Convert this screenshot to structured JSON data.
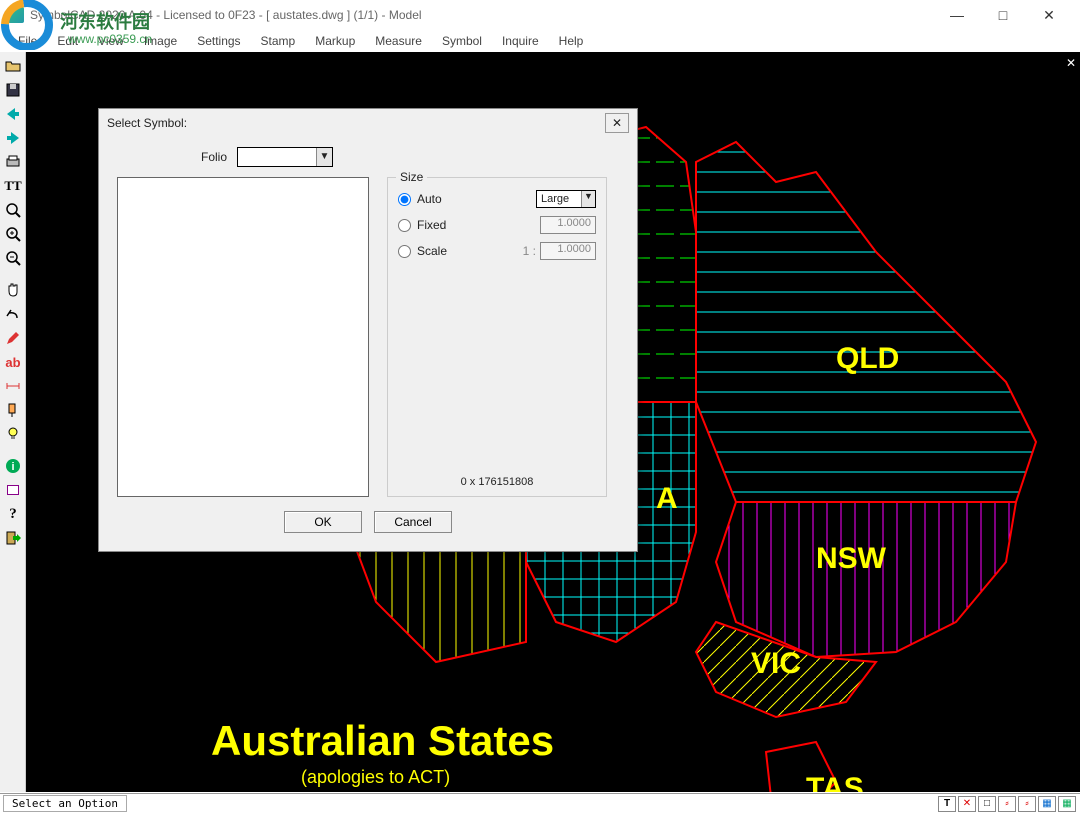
{
  "window": {
    "title": "SymbolCAD 2020 A.04 - Licensed to 0F23  -  [ austates.dwg ] (1/1)  -  Model",
    "min": "—",
    "max": "□",
    "close": "✕"
  },
  "menu": [
    "File",
    "Edit",
    "View",
    "Image",
    "Settings",
    "Stamp",
    "Markup",
    "Measure",
    "Symbol",
    "Inquire",
    "Help"
  ],
  "left_icons": [
    "open",
    "save",
    "arrow-left",
    "arrow-right",
    "print",
    "text-box",
    "zoom",
    "zoom-in",
    "zoom-out",
    "hand",
    "select",
    "undo",
    "pencil",
    "ab",
    "dims",
    "paint",
    "lamp",
    "info",
    "book",
    "help",
    "exit"
  ],
  "canvas": {
    "title": "Australian States",
    "subtitle": "(apologies to ACT)",
    "labels": {
      "qld": "QLD",
      "nsw": "NSW",
      "vic": "VIC",
      "tas": "TAS",
      "sa": "A"
    }
  },
  "dialog": {
    "title": "Select Symbol:",
    "folio_label": "Folio",
    "size_label": "Size",
    "opts": {
      "auto": "Auto",
      "fixed": "Fixed",
      "scale": "Scale"
    },
    "large": "Large",
    "fixed_val": "1.0000",
    "scale_prefix": "1 :",
    "scale_val": "1.0000",
    "counter": "0 x 176151808",
    "ok": "OK",
    "cancel": "Cancel"
  },
  "status": {
    "left": "Select an Option",
    "r": [
      "T",
      "✕",
      "□",
      "⸗",
      "⸗",
      "▦",
      "▦"
    ]
  },
  "watermark": {
    "line1": "河东软件园",
    "line2": "www.pc0359.cn"
  }
}
